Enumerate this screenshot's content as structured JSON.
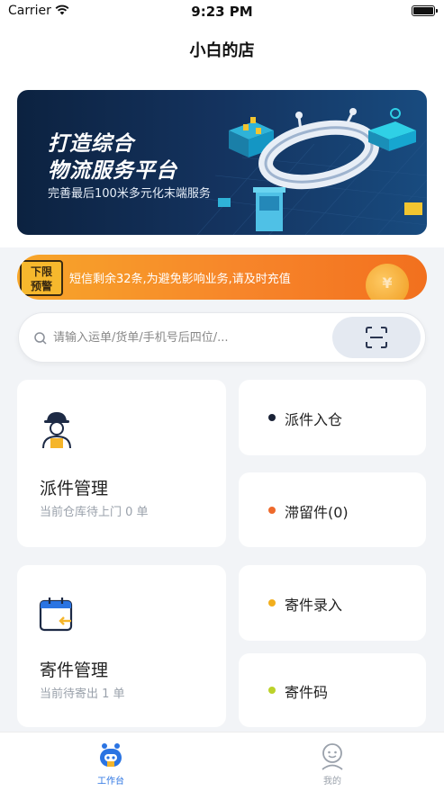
{
  "status_bar": {
    "carrier": "Carrier",
    "time": "9:23 PM"
  },
  "nav": {
    "title": "小白的店"
  },
  "banner": {
    "title_line1": "打造综合",
    "title_line2": "物流服务平台",
    "subtitle": "完善最后100米多元化末端服务"
  },
  "notice": {
    "tag_line1": "下限",
    "tag_line2": "预警",
    "text": "短信剩余32条,为避免影响业务,请及时充值",
    "coin_symbol": "¥"
  },
  "search": {
    "placeholder": "请输入运单/货单/手机号后四位/..."
  },
  "cards": {
    "dispatch": {
      "title": "派件管理",
      "subtitle": "当前仓库待上门 0 单"
    },
    "send": {
      "title": "寄件管理",
      "subtitle": "当前待寄出 1 单"
    },
    "quick": [
      {
        "label": "派件入仓",
        "dot_color": "#1a2236"
      },
      {
        "label": "滞留件(0)",
        "dot_color": "#ee6a2c"
      },
      {
        "label": "寄件录入",
        "dot_color": "#f2ae1c"
      },
      {
        "label": "寄件码",
        "dot_color": "#bcd22a"
      }
    ]
  },
  "tabs": [
    {
      "label": "工作台",
      "active": true,
      "color": "#2b74e2"
    },
    {
      "label": "我的",
      "active": false,
      "color": "#9aa1ab"
    }
  ],
  "colors": {
    "accent": "#2b74e2",
    "notice": "#f7852a",
    "banner_bg": "#0c2240"
  }
}
